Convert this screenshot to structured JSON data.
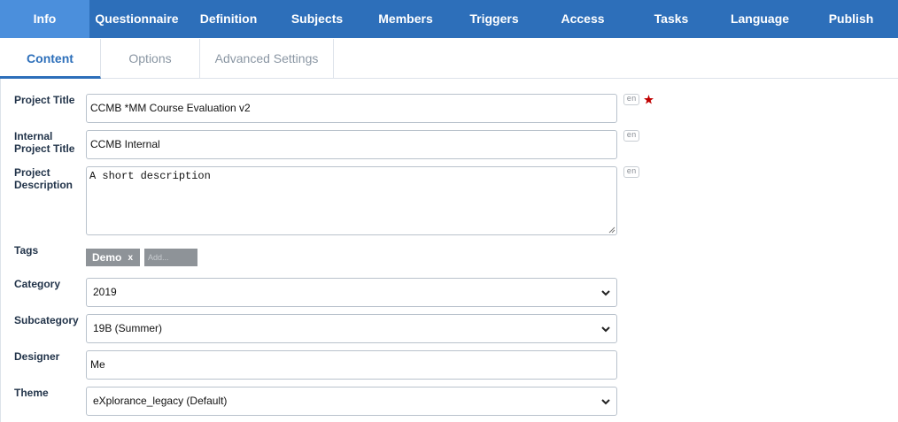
{
  "nav": {
    "items": [
      {
        "label": "Info",
        "active": true
      },
      {
        "label": "Questionnaire"
      },
      {
        "label": "Definition"
      },
      {
        "label": "Subjects"
      },
      {
        "label": "Members"
      },
      {
        "label": "Triggers"
      },
      {
        "label": "Access"
      },
      {
        "label": "Tasks"
      },
      {
        "label": "Language"
      },
      {
        "label": "Publish"
      }
    ]
  },
  "subtabs": [
    {
      "label": "Content",
      "active": true
    },
    {
      "label": "Options"
    },
    {
      "label": "Advanced Settings"
    }
  ],
  "form": {
    "project_title": {
      "label": "Project Title",
      "value": "CCMB *MM Course Evaluation v2",
      "lang": "en",
      "required": true
    },
    "internal_title": {
      "label_line1": "Internal",
      "label_line2": "Project Title",
      "value": "CCMB Internal",
      "lang": "en"
    },
    "description": {
      "label_line1": "Project",
      "label_line2": "Description",
      "value": "A short description",
      "lang": "en"
    },
    "tags": {
      "label": "Tags",
      "items": [
        "Demo"
      ],
      "remove_symbol": "x",
      "add_placeholder": "Add..."
    },
    "category": {
      "label": "Category",
      "selected": "2019"
    },
    "subcategory": {
      "label": "Subcategory",
      "selected": "19B (Summer)"
    },
    "designer": {
      "label": "Designer",
      "value": "Me"
    },
    "theme": {
      "label": "Theme",
      "selected": "eXplorance_legacy (Default)"
    }
  },
  "colors": {
    "nav_bg": "#2d6fba",
    "nav_active": "#4b8fdc",
    "required_star": "#c00000"
  }
}
